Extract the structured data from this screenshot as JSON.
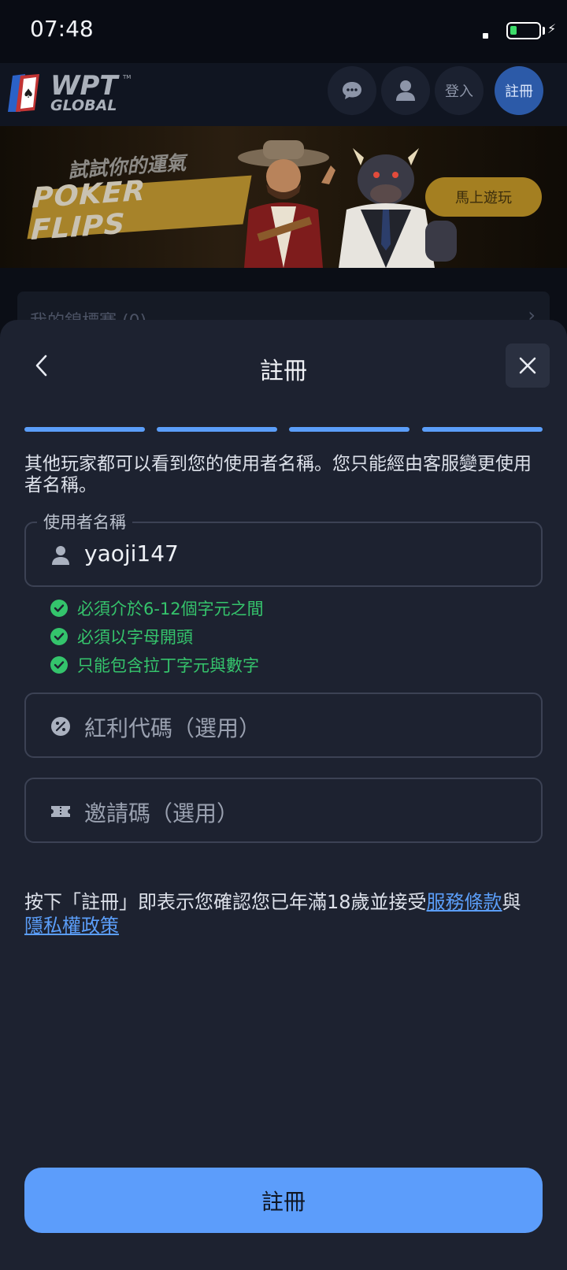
{
  "status_bar": {
    "time": "07:48"
  },
  "header": {
    "logo_text": "WPT GLOBAL",
    "icons": [
      "chat-icon",
      "user-icon"
    ],
    "login_label": "登入",
    "register_label": "註冊"
  },
  "banner": {
    "slogan": "試試你的運氣",
    "title": "POKER FLIPS",
    "play_label": "馬上遊玩"
  },
  "background_card": {
    "label": "我的錦標賽 (0)"
  },
  "sheet": {
    "title": "註冊",
    "progress": {
      "steps_total": 4,
      "steps_done": 4
    },
    "hint": "其他玩家都可以看到您的使用者名稱。您只能經由客服變更使用者名稱。",
    "username": {
      "legend": "使用者名稱",
      "value": "yaoji147",
      "icon": "user-icon"
    },
    "rules": [
      {
        "text": "必須介於6-12個字元之間"
      },
      {
        "text": "必須以字母開頭"
      },
      {
        "text": "只能包含拉丁字元與數字"
      }
    ],
    "bonus_code": {
      "placeholder": "紅利代碼（選用）",
      "icon": "percent-icon"
    },
    "invite_code": {
      "placeholder": "邀請碼（選用）",
      "icon": "ticket-icon"
    },
    "terms": {
      "prefix": "按下「註冊」即表示您確認您已年滿18歲並接受",
      "terms_link": "服務條款",
      "joiner": "與",
      "privacy_link": "隱私權政策"
    },
    "submit_label": "註冊"
  },
  "colors": {
    "accent": "#5c9dfb",
    "success": "#35c46c",
    "sheet_bg": "#1d2230",
    "gold": "#a47f21"
  }
}
